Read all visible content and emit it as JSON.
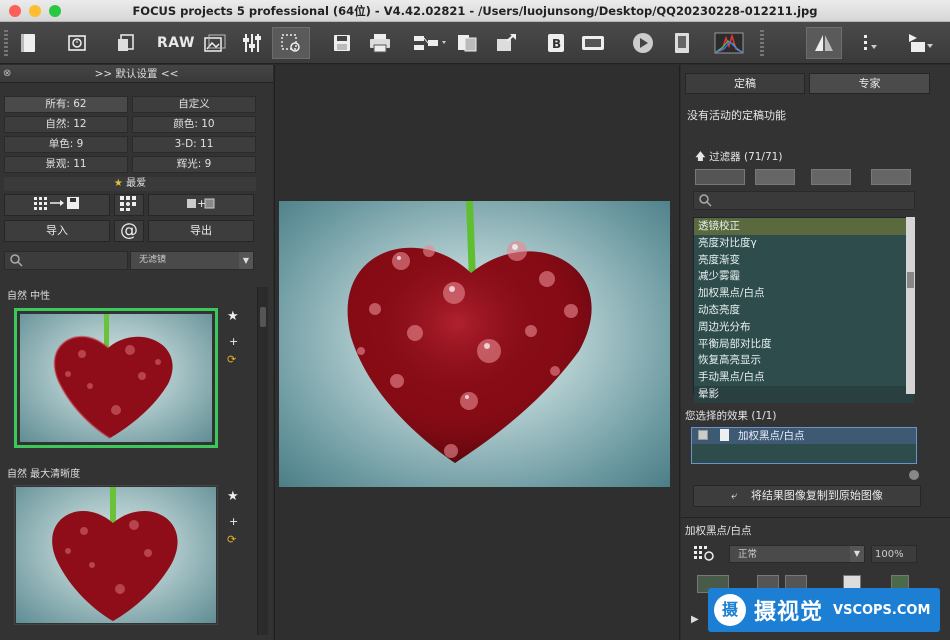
{
  "window": {
    "title": "FOCUS projects 5 professional (64位) - V4.42.02821 - /Users/luojunsong/Desktop/QQ20230228-012211.jpg"
  },
  "toolbar": {
    "raw_label": "RAW"
  },
  "left": {
    "header": ">> 默认设置 <<",
    "categories": [
      {
        "label": "所有: 62"
      },
      {
        "label": "自定义"
      },
      {
        "label": "自然: 12"
      },
      {
        "label": "颜色: 10"
      },
      {
        "label": "单色: 9"
      },
      {
        "label": "3-D: 11"
      },
      {
        "label": "景观: 11"
      },
      {
        "label": "辉光: 9"
      }
    ],
    "favorites": "最爱",
    "import_label": "导入",
    "export_label": "导出",
    "at_label": "@",
    "filter_combo": "无滤镜",
    "preset1": "自然 中性",
    "preset2": "自然 最大清晰度"
  },
  "right": {
    "tab_finalize": "定稿",
    "tab_expert": "专家",
    "no_active": "没有活动的定稿功能",
    "filters_title": "过滤器 (71/71)",
    "filters": [
      "透镜校正",
      "亮度对比度γ",
      "亮度渐变",
      "减少雾霾",
      "加权黑点/白点",
      "动态亮度",
      "周边光分布",
      "平衡局部对比度",
      "恢复高亮显示",
      "手动黑点/白点",
      "晕影"
    ],
    "effects_title": "您选择的效果 (1/1)",
    "effect_item": "加权黑点/白点",
    "copy_label": "将结果图像复制到原始图像",
    "panel_title": "加权黑点/白点",
    "mode": "正常",
    "percent": "100%"
  },
  "watermark": {
    "name": "摄视觉",
    "site": "VSCOPS.COM",
    "logo": "摄"
  }
}
